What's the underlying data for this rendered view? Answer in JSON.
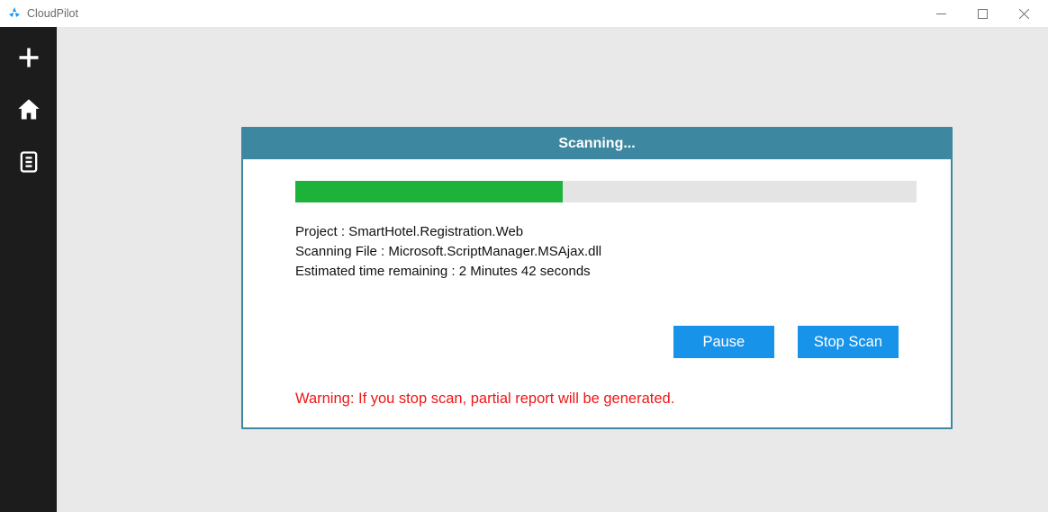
{
  "app": {
    "title": "CloudPilot"
  },
  "dialog": {
    "title": "Scanning...",
    "progress_percent": 43,
    "project_line": "Project : SmartHotel.Registration.Web",
    "file_line": "Scanning File : Microsoft.ScriptManager.MSAjax.dll",
    "eta_line": "Estimated time remaining : 2 Minutes 42 seconds",
    "pause_label": "Pause",
    "stop_label": "Stop Scan",
    "warning": "Warning: If you stop scan, partial report will be generated."
  }
}
